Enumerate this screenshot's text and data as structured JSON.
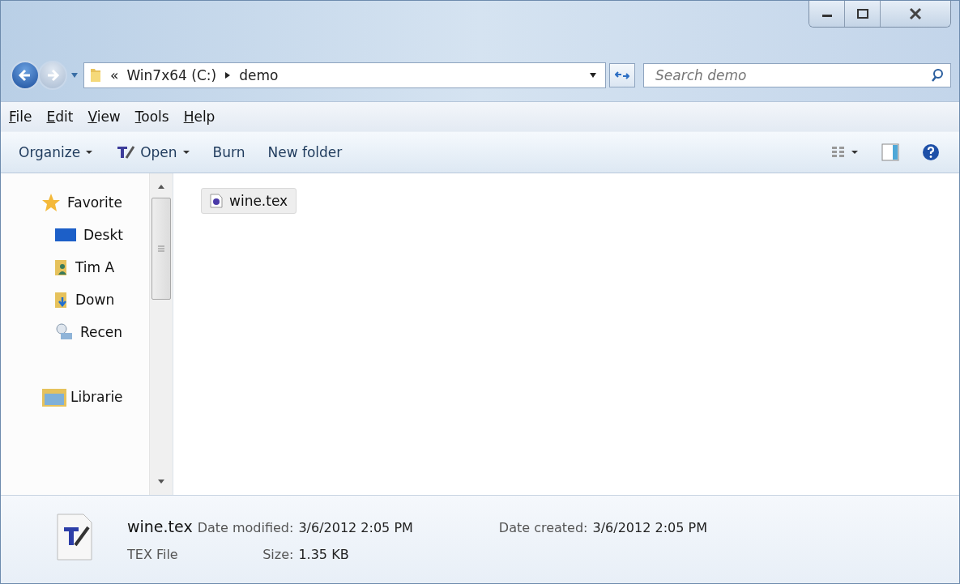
{
  "address": {
    "path": [
      {
        "text": "«"
      },
      {
        "text": "Win7x64 (C:)"
      },
      {
        "text": "demo"
      }
    ]
  },
  "search": {
    "placeholder": "Search demo"
  },
  "menu": [
    "File",
    "Edit",
    "View",
    "Tools",
    "Help"
  ],
  "toolbar": [
    {
      "label": "Organize",
      "kind": "dropdown"
    },
    {
      "label": "Open",
      "kind": "open"
    },
    {
      "label": "Burn",
      "kind": "plain"
    },
    {
      "label": "New folder",
      "kind": "plain"
    }
  ],
  "sidebar": {
    "items": [
      {
        "label": "Favorite",
        "kind": "star"
      },
      {
        "label": "Deskt",
        "kind": "desktop"
      },
      {
        "label": "Tim A",
        "kind": "user"
      },
      {
        "label": "Down",
        "kind": "download"
      },
      {
        "label": "Recen",
        "kind": "recent"
      },
      {
        "label": "Librarie",
        "kind": "library"
      }
    ]
  },
  "files": [
    {
      "name": "wine.tex",
      "selected": true
    }
  ],
  "details": {
    "name": "wine.tex",
    "type": "TEX File",
    "fields": [
      {
        "label": "Date modified:",
        "value": "3/6/2012 2:05 PM"
      },
      {
        "label": "Date created:",
        "value": "3/6/2012 2:05 PM"
      },
      {
        "label": "Size:",
        "value": "1.35 KB"
      }
    ]
  }
}
